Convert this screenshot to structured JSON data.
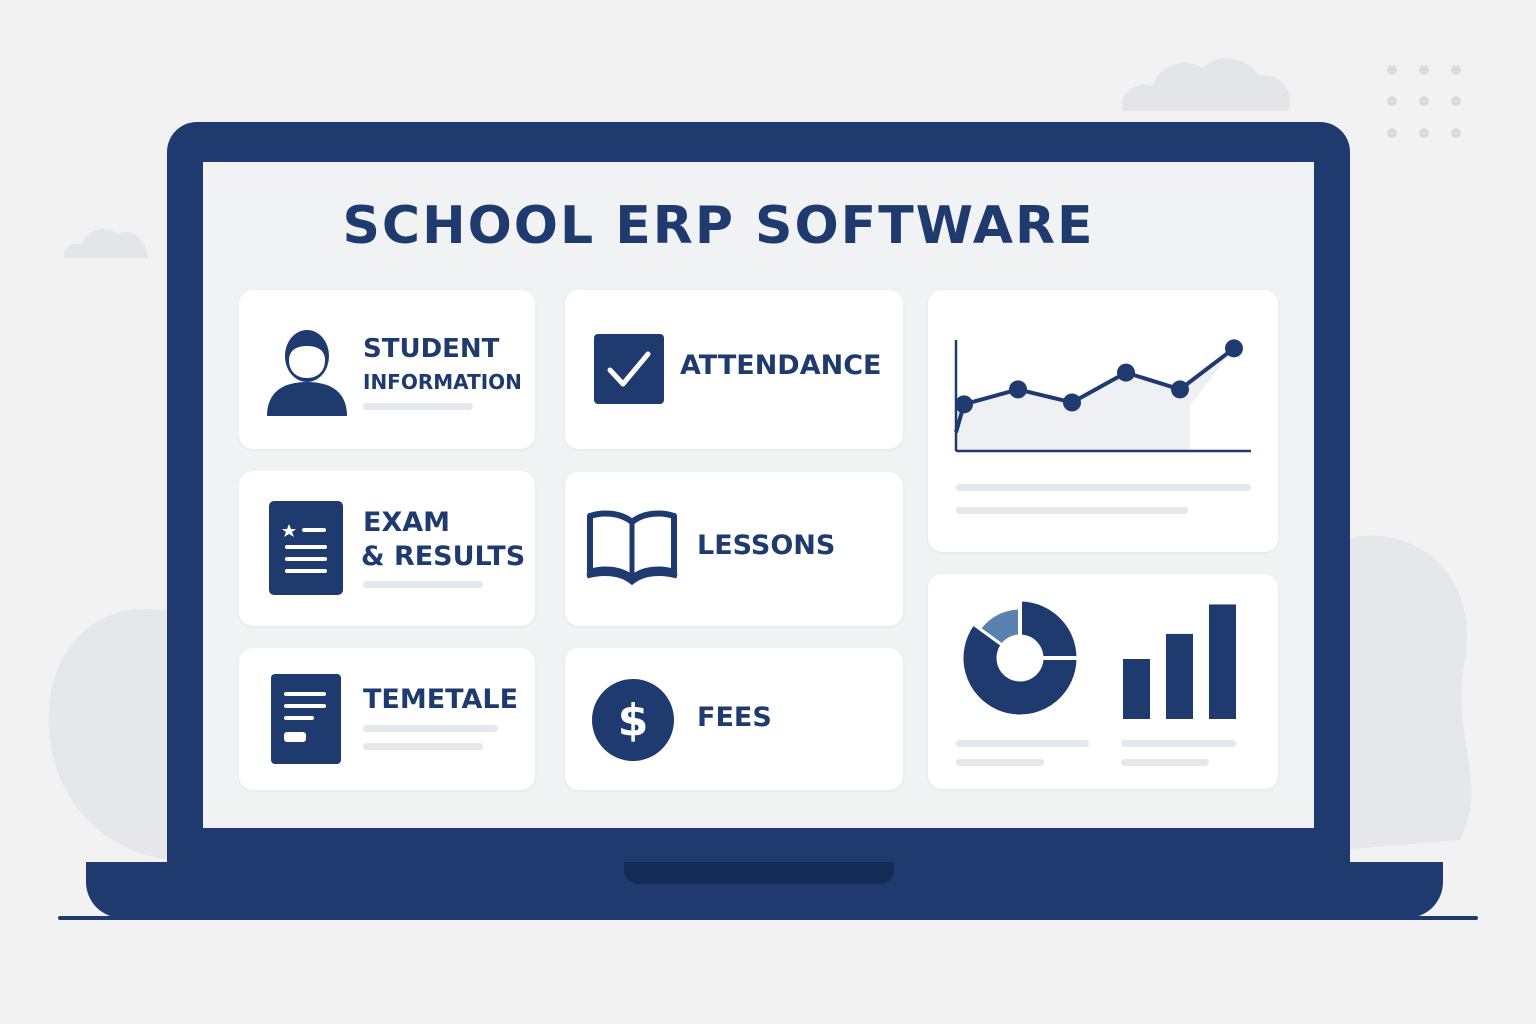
{
  "screen": {
    "title": "SCHOOL ERP SOFTWARE"
  },
  "modules": {
    "student": {
      "line1": "STUDENT",
      "line2": "INFORMATION",
      "icon": "user-icon"
    },
    "attendance": {
      "label": "ATTENDANCE",
      "icon": "checkbox-icon"
    },
    "exam": {
      "line1": "EXAM",
      "line2": "& RESULTS",
      "icon": "report-card-icon"
    },
    "lessons": {
      "label": "LESSONS",
      "icon": "book-icon"
    },
    "timetable": {
      "label": "TEMETALE",
      "icon": "document-icon"
    },
    "fees": {
      "label": "FEES",
      "icon": "dollar-icon"
    }
  },
  "colors": {
    "primary": "#1e3a6e",
    "accent": "#5a82b0",
    "card": "#ffffff",
    "screen": "#f1f2f4",
    "placeholder": "#e4e7ec"
  },
  "chart_data": [
    {
      "type": "line",
      "x": [
        1,
        2,
        3,
        4,
        5,
        6
      ],
      "values": [
        2.5,
        3.3,
        2.6,
        4.2,
        3.3,
        5.5
      ],
      "ylim": [
        0,
        6
      ],
      "grid": false
    },
    {
      "type": "pie",
      "values": [
        85,
        15
      ],
      "donut": true
    },
    {
      "type": "bar",
      "categories": [
        "1",
        "2",
        "3"
      ],
      "values": [
        55,
        78,
        105
      ],
      "ylim": [
        0,
        110
      ]
    }
  ]
}
